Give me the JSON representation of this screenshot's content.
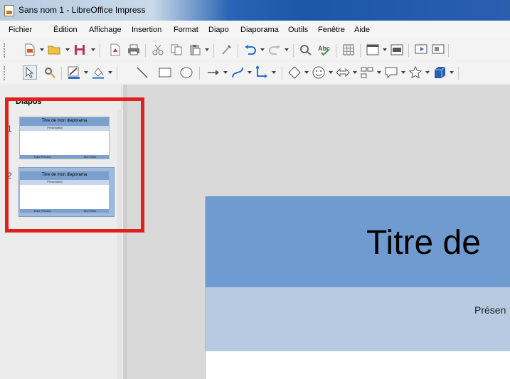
{
  "window": {
    "title": "Sans nom 1 - LibreOffice Impress"
  },
  "menu": [
    "Fichier",
    "Édition",
    "Affichage",
    "Insertion",
    "Format",
    "Diapo",
    "Diaporama",
    "Outils",
    "Fenêtre",
    "Aide"
  ],
  "slide_pane": {
    "title": "Diapos",
    "close": "×",
    "slides": [
      {
        "number": "1",
        "title": "Titre de mon diaporama",
        "subtitle": "Présentation",
        "footer_left": "Date Présent.",
        "footer_right": "Mon Nom"
      },
      {
        "number": "2",
        "title": "Titre de mon diaporama",
        "subtitle": "Présentation",
        "footer_left": "Date Présent.",
        "footer_right": "Mon Nom"
      }
    ]
  },
  "slide": {
    "title": "Titre de",
    "subtitle": "Présen"
  },
  "colors": {
    "accent_highlight": "#e0211b",
    "slide_header": "#6f9bd0",
    "slide_band": "#b8c9e2"
  }
}
